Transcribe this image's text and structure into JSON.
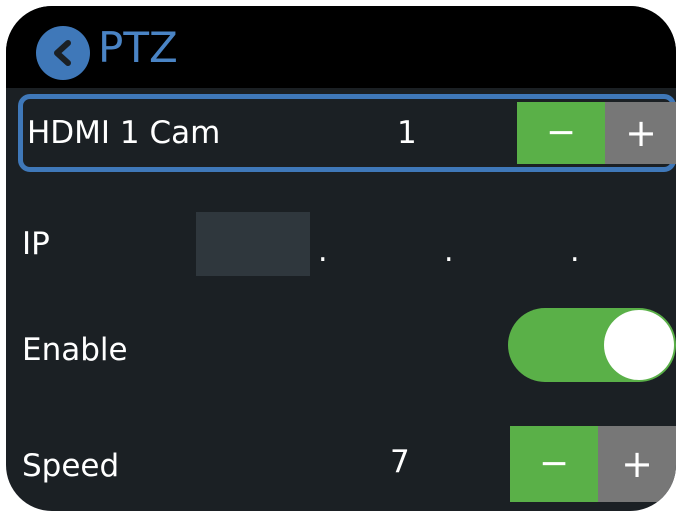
{
  "header": {
    "title": "PTZ"
  },
  "hdmi_row": {
    "label": "HDMI 1 Cam",
    "value": "1",
    "minus_label": "−",
    "plus_label": "+"
  },
  "ip_row": {
    "label": "IP",
    "octet_separators": [
      ".",
      ".",
      "."
    ]
  },
  "enable_row": {
    "label": "Enable",
    "toggle_state": "on"
  },
  "speed_row": {
    "label": "Speed",
    "value": "7",
    "minus_label": "−",
    "plus_label": "+"
  },
  "colors": {
    "accent_blue": "#3f78b9",
    "active_green": "#5ab048",
    "inactive_gray": "#777777",
    "panel_dark": "#1b2024"
  }
}
